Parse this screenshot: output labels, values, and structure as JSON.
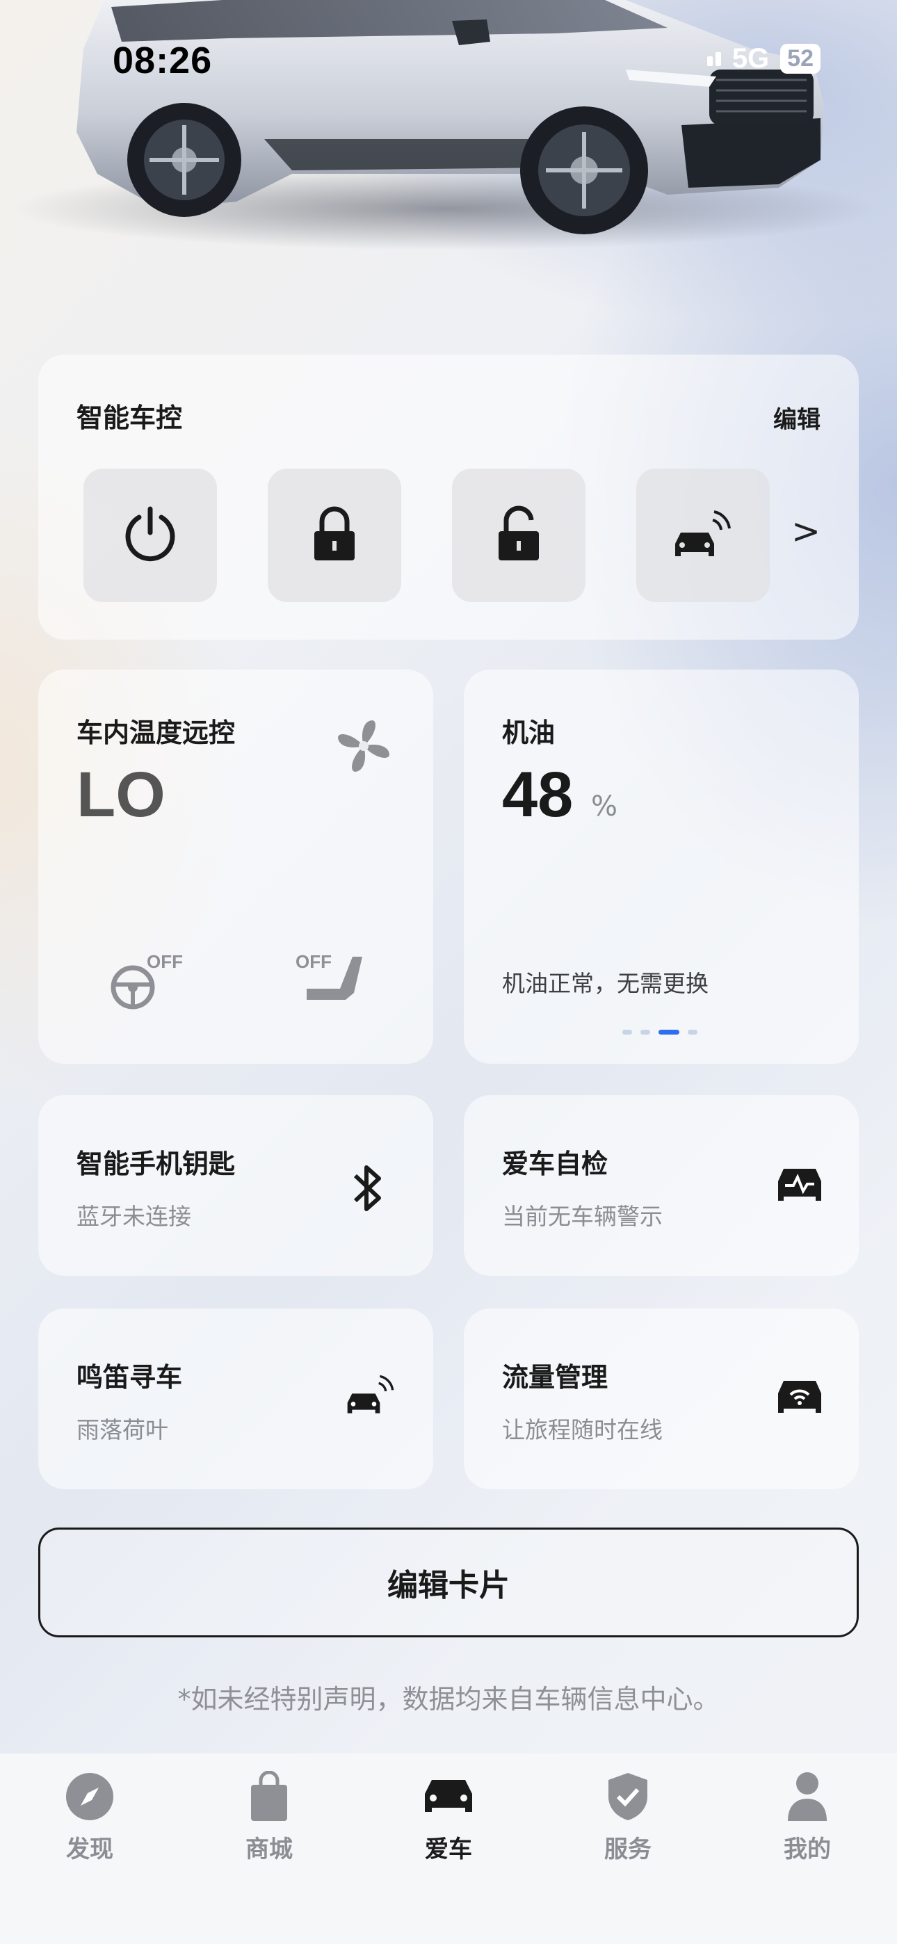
{
  "status_bar": {
    "time": "08:26",
    "network": "5G",
    "battery": "52"
  },
  "smart_control": {
    "title": "智能车控",
    "edit_label": "编辑",
    "buttons": [
      {
        "name": "power",
        "icon": "power-icon"
      },
      {
        "name": "lock",
        "icon": "lock-icon"
      },
      {
        "name": "unlock",
        "icon": "unlock-icon"
      },
      {
        "name": "honk-find",
        "icon": "car-signal-icon"
      }
    ],
    "more_label": ">"
  },
  "temperature_card": {
    "title": "车内温度远控",
    "value": "LO",
    "steering_heat": "OFF",
    "seat_heat": "OFF"
  },
  "oil_card": {
    "title": "机油",
    "value": "48",
    "unit": "%",
    "status": "机油正常，无需更换",
    "page_count": 4,
    "active_page": 3
  },
  "tiles": [
    {
      "title": "智能手机钥匙",
      "subtitle": "蓝牙未连接",
      "icon": "bluetooth-icon"
    },
    {
      "title": "爱车自检",
      "subtitle": "当前无车辆警示",
      "icon": "car-diagnostic-icon"
    },
    {
      "title": "鸣笛寻车",
      "subtitle": "雨落荷叶",
      "icon": "car-signal-icon"
    },
    {
      "title": "流量管理",
      "subtitle": "让旅程随时在线",
      "icon": "car-wifi-icon"
    }
  ],
  "edit_cards_label": "编辑卡片",
  "disclaimer": "*如未经特别声明，数据均来自车辆信息中心。",
  "tabbar": {
    "items": [
      {
        "label": "发现",
        "icon": "compass-icon"
      },
      {
        "label": "商城",
        "icon": "shopping-bag-icon"
      },
      {
        "label": "爱车",
        "icon": "car-icon",
        "active": true
      },
      {
        "label": "服务",
        "icon": "shield-check-icon"
      },
      {
        "label": "我的",
        "icon": "person-icon"
      }
    ]
  }
}
